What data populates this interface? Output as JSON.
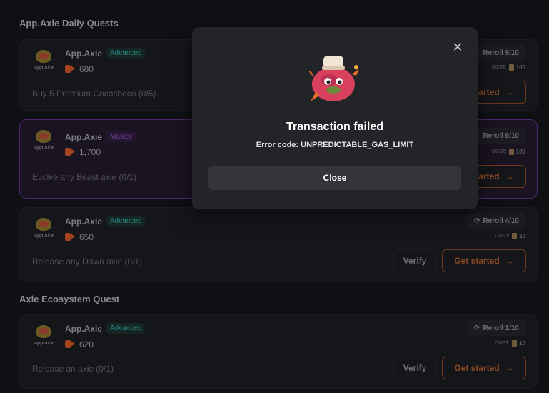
{
  "sections": {
    "daily_title": "App.Axie Daily Quests",
    "eco_title": "Axie Ecosystem Quest"
  },
  "quests": [
    {
      "app": "App.Axie",
      "tier": "Advanced",
      "points": "680",
      "task": "Buy 5 Premium Cocochoco (0/5)",
      "reroll": "Reroll 9/10",
      "cost_label": "COST:",
      "cost": "100",
      "start_label": "Get started"
    },
    {
      "app": "App.Axie",
      "tier": "Master",
      "points": "1,700",
      "task": "Evolve any Beast axie (0/1)",
      "reroll": "Reroll 9/10",
      "cost_label": "COST:",
      "cost": "100",
      "start_label": "Get started"
    },
    {
      "app": "App.Axie",
      "tier": "Advanced",
      "points": "650",
      "task": "Release any Dawn axie (0/1)",
      "reroll": "Reroll 4/10",
      "cost_label": "COST:",
      "cost": "20",
      "verify_label": "Verify",
      "start_label": "Get started"
    },
    {
      "app": "App.Axie",
      "tier": "Advanced",
      "points": "620",
      "task": "Release an axie (0/1)",
      "reroll": "Reroll 1/10",
      "cost_label": "COST:",
      "cost": "10",
      "verify_label": "Verify",
      "start_label": "Get started"
    }
  ],
  "logo_label": "app.axie",
  "modal": {
    "title": "Transaction failed",
    "message": "Error code: UNPREDICTABLE_GAS_LIMIT",
    "close_label": "Close",
    "close_icon": "close-icon",
    "mascot": "axie-mascot-image"
  },
  "colors": {
    "accent_orange": "#8a4b25",
    "advanced_badge": "#2a8a84",
    "master_badge": "#6b3e93",
    "modal_bg": "#232428"
  }
}
